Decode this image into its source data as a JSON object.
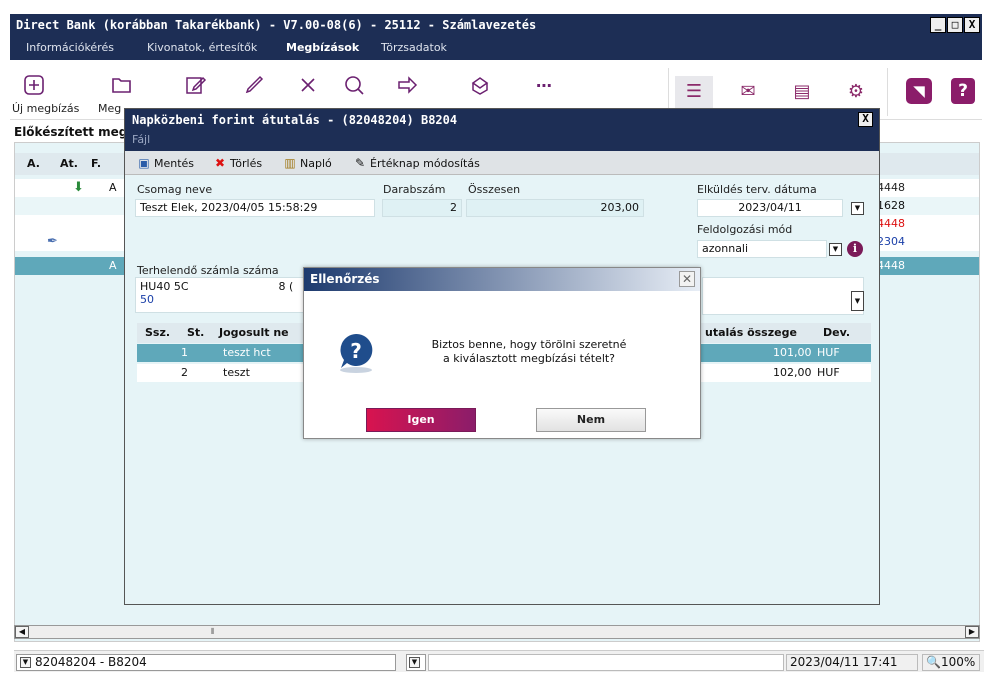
{
  "window": {
    "title": "Direct Bank (korábban Takarékbank) - V7.00-08(6) - 25112 - Számlavezetés",
    "controls": [
      "_",
      "□",
      "X"
    ]
  },
  "menu": [
    "Információkérés",
    "Kivonatok, értesítők",
    "Megbízások",
    "Törzsadatok"
  ],
  "toolbar": {
    "labels": [
      "Új megbízás",
      "Meg"
    ]
  },
  "page": {
    "subtitle": "Előkészített meg"
  },
  "list": {
    "headers": [
      "A.",
      "At.",
      "F."
    ],
    "rows": [
      {
        "col_a": "",
        "col_at": "A",
        "right": "4448",
        "selected": false
      },
      {
        "col_a": "",
        "col_at": "",
        "right": "1628",
        "selected": false
      },
      {
        "col_a": "",
        "col_at": "",
        "right": "4448",
        "selected": false
      },
      {
        "col_a": "",
        "col_at": "",
        "right": "2304",
        "selected": false
      },
      {
        "col_a": "",
        "col_at": "A",
        "right": "4448",
        "selected": true
      }
    ]
  },
  "modal": {
    "title": "Napközbeni forint átutalás - (82048204) B8204",
    "menu": "Fájl",
    "close": "X",
    "toolbar": {
      "save": "Mentés",
      "delete": "Törlés",
      "log": "Napló",
      "value_date": "Értéknap módosítás"
    },
    "fields": {
      "package_name_label": "Csomag neve",
      "package_name": "Teszt Elek, 2023/04/05 15:58:29",
      "count_label": "Darabszám",
      "count": "2",
      "total_label": "Összesen",
      "total": "203,00",
      "send_date_label": "Elküldés terv. dátuma",
      "send_date": "2023/04/11",
      "processing_label": "Feldolgozási mód",
      "processing": "azonnali",
      "account_label": "Terhelendő számla száma",
      "account_line1": "HU40 5C",
      "account_line1b": "8 (",
      "account_line2": "50"
    },
    "table": {
      "headers": {
        "ssz": "Ssz.",
        "st": "St.",
        "name": "Jogosult ne",
        "amount": "utalás összege",
        "dev": "Dev."
      },
      "rows": [
        {
          "ssz": "1",
          "name": "teszt hct",
          "amount": "101,00",
          "dev": "HUF",
          "selected": true
        },
        {
          "ssz": "2",
          "name": "teszt",
          "amount": "102,00",
          "dev": "HUF",
          "selected": false
        }
      ]
    }
  },
  "confirm": {
    "title": "Ellenőrzés",
    "close": "✕",
    "message_line1": "Biztos benne, hogy törölni szeretné",
    "message_line2": "a kiválasztott megbízási tételt?",
    "yes": "Igen",
    "no": "Nem"
  },
  "statusbar": {
    "account": "82048204 - B8204",
    "datetime": "2023/04/11 17:41",
    "zoom": "100%"
  },
  "colors": {
    "titlebar": "#1d2e55",
    "accent": "#8b1d6a",
    "selected_row": "#5fa8ba",
    "panel_bg": "#e6f4f7"
  }
}
